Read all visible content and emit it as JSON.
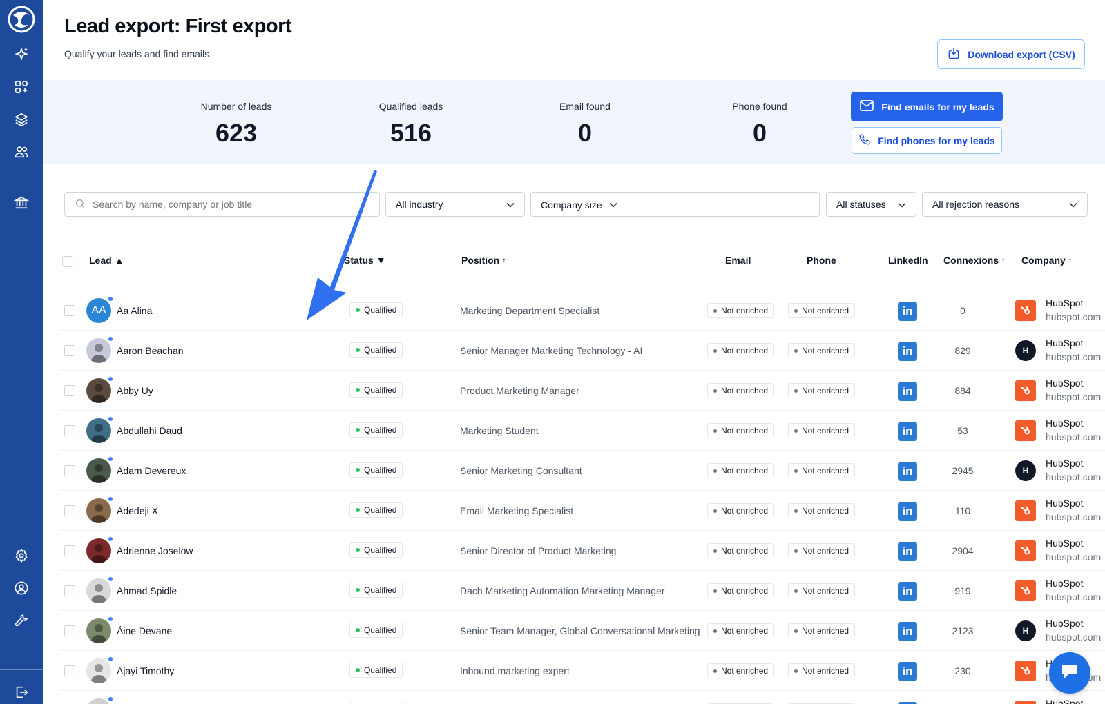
{
  "sidebar": {
    "icons": [
      "logo-icon",
      "sparkles-icon",
      "apps-icon",
      "layers-icon",
      "users-icon",
      "bank-icon",
      "gear-icon",
      "account-icon",
      "wrench-icon",
      "logout-icon"
    ]
  },
  "header": {
    "title": "Lead export: First export",
    "subtitle": "Qualify your leads and find emails.",
    "download_label": "Download export (CSV)"
  },
  "stats": [
    {
      "label": "Number of leads",
      "value": "623"
    },
    {
      "label": "Qualified leads",
      "value": "516"
    },
    {
      "label": "Email found",
      "value": "0"
    },
    {
      "label": "Phone found",
      "value": "0"
    }
  ],
  "actions": {
    "find_emails": "Find emails for my leads",
    "find_phones": "Find phones for my leads"
  },
  "filters": {
    "search_placeholder": "Search by name, company or job title",
    "industry": "All industry",
    "company_size": "Company size",
    "statuses": "All statuses",
    "rejection": "All rejection reasons"
  },
  "table": {
    "columns": {
      "lead": "Lead",
      "status": "Status",
      "position": "Position",
      "email": "Email",
      "phone": "Phone",
      "linkedin": "LinkedIn",
      "connexions": "Connexions",
      "company": "Company"
    },
    "rows": [
      {
        "name": "Aa Alina",
        "initials": "AA",
        "status": "Qualified",
        "position": "Marketing Department Specialist",
        "email": "Not enriched",
        "phone": "Not enriched",
        "linkedin": "in",
        "connexions": "0",
        "company": "HubSpot",
        "domain": "hubspot.com",
        "logo": "hs",
        "avatar_color": "#2b86d6"
      },
      {
        "name": "Aaron Beachan",
        "initials": "",
        "status": "Qualified",
        "position": "Senior Manager Marketing Technology - AI",
        "email": "Not enriched",
        "phone": "Not enriched",
        "linkedin": "in",
        "connexions": "829",
        "company": "HubSpot",
        "domain": "hubspot.com",
        "logo": "h",
        "avatar_color": "#c7c9d9"
      },
      {
        "name": "Abby Uy",
        "initials": "",
        "status": "Qualified",
        "position": "Product Marketing Manager",
        "email": "Not enriched",
        "phone": "Not enriched",
        "linkedin": "in",
        "connexions": "884",
        "company": "HubSpot",
        "domain": "hubspot.com",
        "logo": "hs",
        "avatar_color": "#5b4a3f"
      },
      {
        "name": "Abdullahi Daud",
        "initials": "",
        "status": "Qualified",
        "position": "Marketing Student",
        "email": "Not enriched",
        "phone": "Not enriched",
        "linkedin": "in",
        "connexions": "53",
        "company": "HubSpot",
        "domain": "hubspot.com",
        "logo": "hs",
        "avatar_color": "#3f6f86"
      },
      {
        "name": "Adam Devereux",
        "initials": "",
        "status": "Qualified",
        "position": "Senior Marketing Consultant",
        "email": "Not enriched",
        "phone": "Not enriched",
        "linkedin": "in",
        "connexions": "2945",
        "company": "HubSpot",
        "domain": "hubspot.com",
        "logo": "h",
        "avatar_color": "#4a5a4a"
      },
      {
        "name": "Adedeji X",
        "initials": "",
        "status": "Qualified",
        "position": "Email Marketing Specialist",
        "email": "Not enriched",
        "phone": "Not enriched",
        "linkedin": "in",
        "connexions": "110",
        "company": "HubSpot",
        "domain": "hubspot.com",
        "logo": "hs",
        "avatar_color": "#8a6a4a"
      },
      {
        "name": "Adrienne Joselow",
        "initials": "",
        "status": "Qualified",
        "position": "Senior Director of Product Marketing",
        "email": "Not enriched",
        "phone": "Not enriched",
        "linkedin": "in",
        "connexions": "2904",
        "company": "HubSpot",
        "domain": "hubspot.com",
        "logo": "hs",
        "avatar_color": "#7a2a2a"
      },
      {
        "name": "Ahmad Spidle",
        "initials": "",
        "status": "Qualified",
        "position": "Dach Marketing Automation Marketing Manager",
        "email": "Not enriched",
        "phone": "Not enriched",
        "linkedin": "in",
        "connexions": "919",
        "company": "HubSpot",
        "domain": "hubspot.com",
        "logo": "hs",
        "avatar_color": "#d9d9d9"
      },
      {
        "name": "Áine Devane",
        "initials": "",
        "status": "Qualified",
        "position": "Senior Team Manager, Global Conversational Marketing",
        "email": "Not enriched",
        "phone": "Not enriched",
        "linkedin": "in",
        "connexions": "2123",
        "company": "HubSpot",
        "domain": "hubspot.com",
        "logo": "h",
        "avatar_color": "#7a8a6a"
      },
      {
        "name": "Ajayi Timothy",
        "initials": "",
        "status": "Qualified",
        "position": "Inbound marketing expert",
        "email": "Not enriched",
        "phone": "Not enriched",
        "linkedin": "in",
        "connexions": "230",
        "company": "HubSpot",
        "domain": "hubspot.com",
        "logo": "hs",
        "avatar_color": "#e5e5e5"
      },
      {
        "name": "",
        "initials": "",
        "status": "Qualified",
        "position": "",
        "email": "Not enriched",
        "phone": "Not enriched",
        "linkedin": "in",
        "connexions": "",
        "company": "HubSpot",
        "domain": "",
        "logo": "hs",
        "avatar_color": "#cfcfcf"
      }
    ]
  },
  "colors": {
    "sidebar": "#1d4a9a",
    "primary": "#2563eb",
    "stats_bg": "#f1f6fd",
    "arrow": "#2f6ff0"
  }
}
